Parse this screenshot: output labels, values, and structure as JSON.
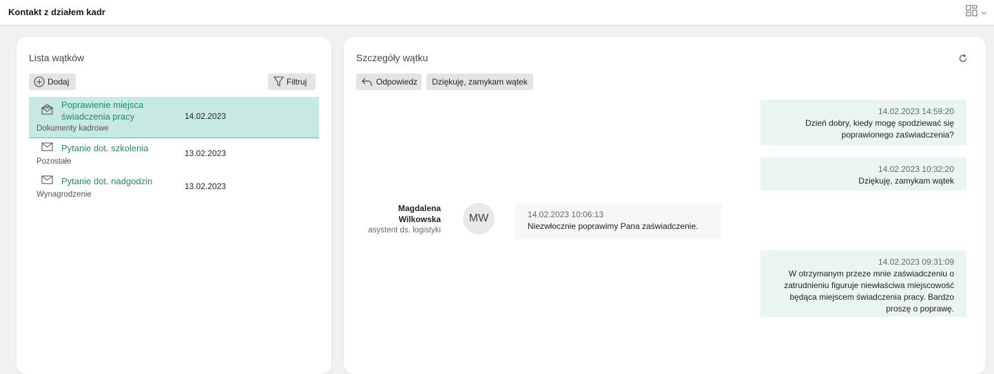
{
  "app": {
    "title": "Kontakt z działem kadr"
  },
  "colors": {
    "accent": "#1e8a72",
    "selected_row": "#c7e9e1",
    "bubble": "#e9f5f2"
  },
  "thread_list": {
    "title": "Lista wątków",
    "add_label": "Dodaj",
    "filter_label": "Filtruj",
    "items": [
      {
        "title": "Poprawienie miejsca świadczenia pracy",
        "date": "14.02.2023",
        "category": "Dokumenty kadrowe",
        "icon": "envelope-open-icon",
        "selected": true
      },
      {
        "title": "Pytanie dot. szkolenia",
        "date": "13.02.2023",
        "category": "Pozostałe",
        "icon": "envelope-icon",
        "selected": false
      },
      {
        "title": "Pytanie dot. nadgodzin",
        "date": "13.02.2023",
        "category": "Wynagrodzenie",
        "icon": "envelope-icon",
        "selected": false
      }
    ]
  },
  "thread_details": {
    "title": "Szczegóły wątku",
    "reply_label": "Odpowiedz",
    "close_label": "Dziękuję, zamykam wątek",
    "messages": [
      {
        "timestamp": "14.02.2023 14:59:20",
        "text": "Dzień dobry, kiedy mogę spodziewać się poprawionego zaświadczenia?"
      },
      {
        "timestamp": "14.02.2023 10:32:20",
        "text": "Dziękuję, zamykam wątek"
      },
      {
        "timestamp": "14.02.2023 10:06:13",
        "text": "Niezwłocznie poprawimy Pana zaświadczenie.",
        "sender_name": "Magdalena Wilkowska",
        "sender_role": "asystent ds. logistyki",
        "avatar_initials": "MW"
      },
      {
        "timestamp": "14.02.2023 09:31:09",
        "text": "W otrzymanym przeze mnie zaświadczeniu o zatrudnieniu figuruje niewłaściwa miejscowość będąca miejscem świadczenia pracy. Bardzo proszę o poprawę."
      }
    ]
  }
}
